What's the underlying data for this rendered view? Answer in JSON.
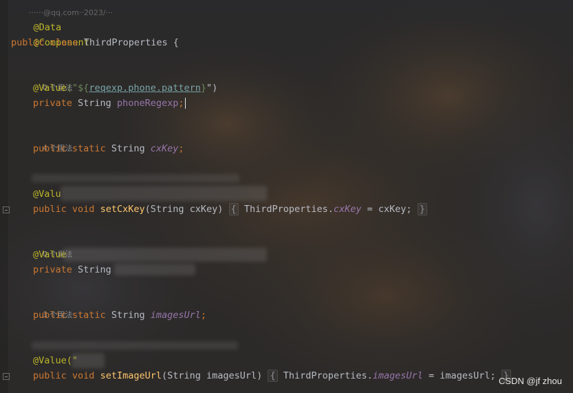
{
  "editor": {
    "colors": {
      "background": "#2b2a29",
      "keyword": "#cc7832",
      "annotation": "#bbb529",
      "string": "#6a8759",
      "field": "#9876aa",
      "method": "#ffc66d",
      "text": "#b8bcc4",
      "hint": "#8e8e8e"
    },
    "top_cut_text": "······@qq.com··2023/···",
    "lines": {
      "ann_data": "@Data",
      "ann_component": "@Component",
      "class_public": "public",
      "class_class": "class",
      "class_name": "ThirdProperties",
      "class_brace": "{",
      "usage_0a": "0 个用法",
      "value1_ann": "@Value",
      "value1_open": "(\"",
      "value1_placeholder_open": "${",
      "value1_placeholder": "reqexp.phone.pattern",
      "value1_placeholder_close": "}",
      "value1_close": "\")",
      "phone_private": "private",
      "phone_type": "String",
      "phone_name": "phoneRegexp",
      "phone_semi": ";",
      "usage_4": "4 个用法",
      "cx_public": "public",
      "cx_static": "static",
      "cx_type": "String",
      "cx_name": "cxKey",
      "cx_semi": ";",
      "value2_ann": "@Valu",
      "setcx_public": "public",
      "setcx_void": "void",
      "setcx_name": "setCxKey",
      "setcx_params": "(String cxKey)",
      "setcx_body_open": "{",
      "setcx_body_class": "ThirdProperties.",
      "setcx_body_field": "cxKey",
      "setcx_body_assign": " = cxKey;",
      "setcx_body_close": "}",
      "usage_0b": "0 个用法",
      "value3_ann": "@Value",
      "priv2_private": "private",
      "priv2_type": "String",
      "usage_3": "3 个用法",
      "img_public": "public",
      "img_static": "static",
      "img_type": "String",
      "img_name": "imagesUrl",
      "img_semi": ";",
      "value4_ann": "@Value(\"",
      "setimg_public": "public",
      "setimg_void": "void",
      "setimg_name": "setImageUrl",
      "setimg_params": "(String imagesUrl)",
      "setimg_body_open": "{",
      "setimg_body_class": "ThirdProperties.",
      "setimg_body_field": "imagesUrl",
      "setimg_body_assign": " = imagesUrl;",
      "setimg_body_close": "}"
    }
  },
  "watermark": "CSDN @jf zhou"
}
